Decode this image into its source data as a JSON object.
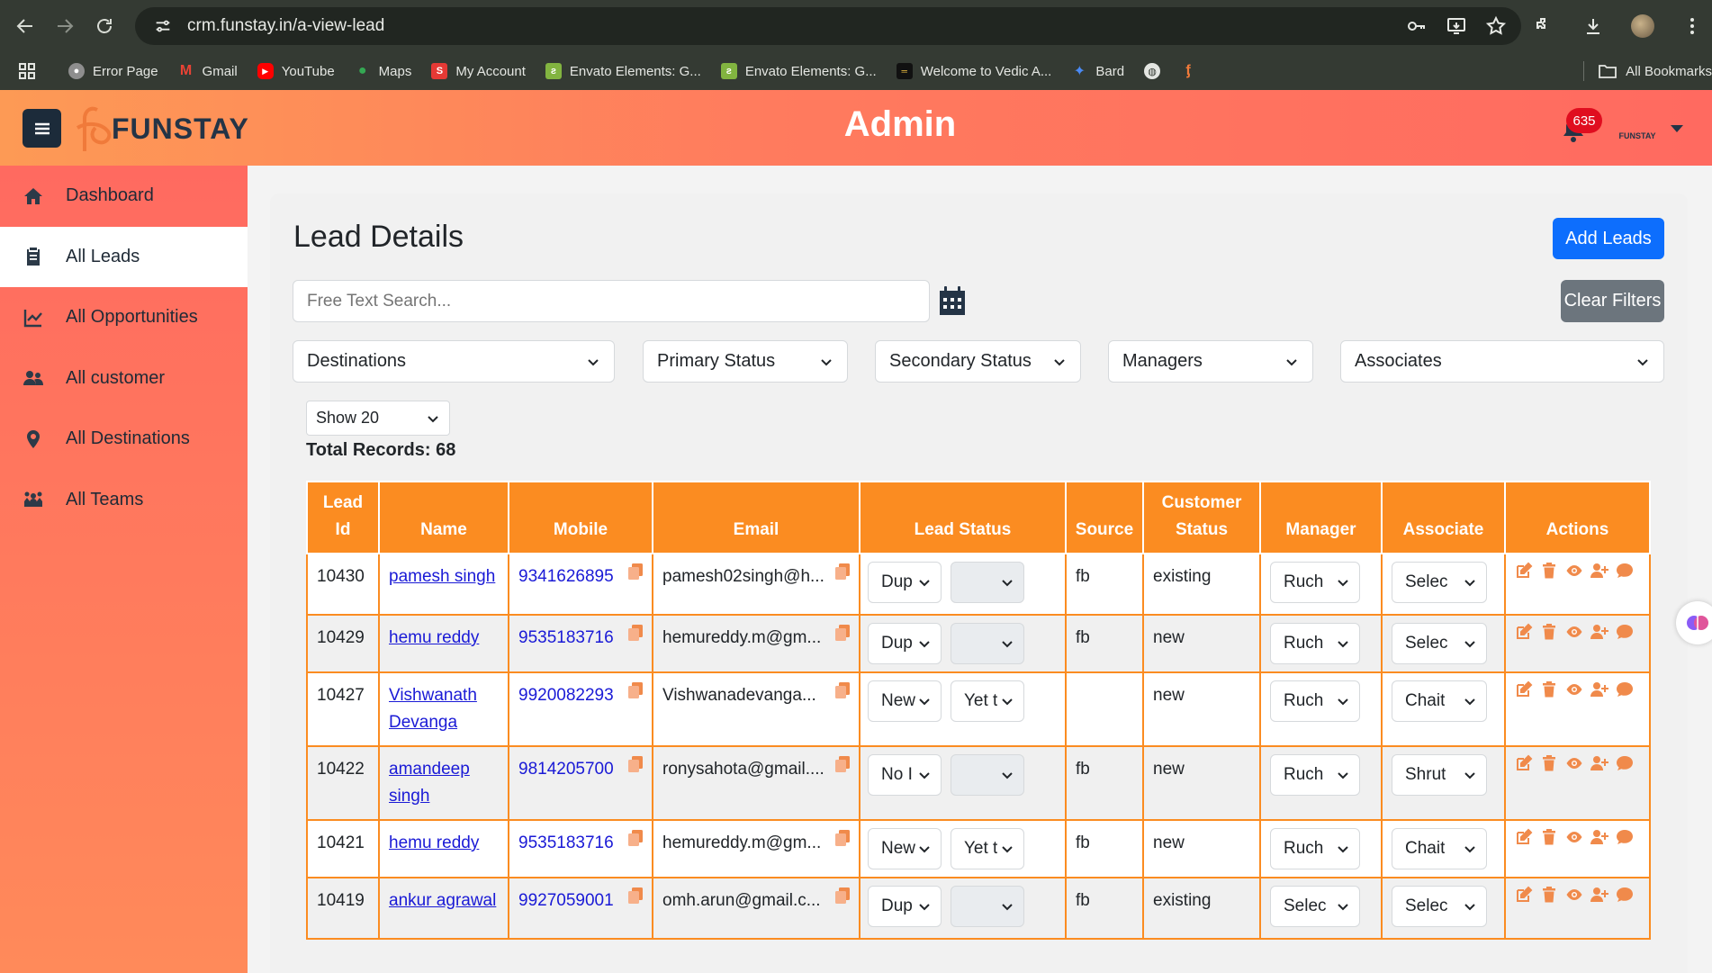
{
  "browser": {
    "url": "crm.funstay.in/a-view-lead",
    "bookmarks": [
      {
        "label": "Error Page",
        "icon": "globe-user-icon",
        "color": "#8e8e8e"
      },
      {
        "label": "Gmail",
        "icon": "gmail-icon",
        "color": "#ea4335"
      },
      {
        "label": "YouTube",
        "icon": "youtube-icon",
        "color": "#ff0000"
      },
      {
        "label": "Maps",
        "icon": "maps-icon",
        "color": "#34a853"
      },
      {
        "label": "My Account",
        "icon": "s-icon",
        "color": "#e53935"
      },
      {
        "label": "Envato Elements: G...",
        "icon": "envato-icon",
        "color": "#82b440"
      },
      {
        "label": "Envato Elements: G...",
        "icon": "envato-icon",
        "color": "#82b440"
      },
      {
        "label": "Welcome to Vedic A...",
        "icon": "vedic-icon",
        "color": "#111111"
      },
      {
        "label": "Bard",
        "icon": "bard-icon",
        "color": "#4a8af4"
      }
    ],
    "all_bookmarks": "All Bookmarks"
  },
  "header": {
    "brand": "FUNSTAY",
    "title": "Admin",
    "notification_count": "635",
    "profile_brand": "FUNSTAY",
    "accent": "#ff7b5e",
    "navy": "#1c2b3a"
  },
  "sidebar": {
    "items": [
      {
        "label": "Dashboard",
        "icon": "home-icon",
        "active": false
      },
      {
        "label": "All Leads",
        "icon": "clipboard-icon",
        "active": true
      },
      {
        "label": "All Opportunities",
        "icon": "chart-line-icon",
        "active": false
      },
      {
        "label": "All customer",
        "icon": "users-icon",
        "active": false
      },
      {
        "label": "All Destinations",
        "icon": "map-pin-icon",
        "active": false
      },
      {
        "label": "All Teams",
        "icon": "team-icon",
        "active": false
      }
    ]
  },
  "main": {
    "title": "Lead Details",
    "add_button": "Add Leads",
    "clear_button": "Clear Filters",
    "search_placeholder": "Free Text Search...",
    "filters": [
      "Destinations",
      "Primary Status",
      "Secondary Status",
      "Managers",
      "Associates"
    ],
    "page_size": "Show 20",
    "total_records": "Total Records: 68"
  },
  "table": {
    "headers": [
      "Lead Id",
      "Name",
      "Mobile",
      "Email",
      "Lead Status",
      "Source",
      "Customer Status",
      "Manager",
      "Associate",
      "Actions"
    ],
    "rows": [
      {
        "id": "10430",
        "name": "pamesh singh",
        "mobile": "9341626895",
        "email": "pamesh02singh@h...",
        "primary": "Dup",
        "secondary": "",
        "source": "fb",
        "customer_status": "existing",
        "manager": "Ruch",
        "associate": "Selec"
      },
      {
        "id": "10429",
        "name": "hemu reddy",
        "mobile": "9535183716",
        "email": "hemureddy.m@gm...",
        "primary": "Dup",
        "secondary": "",
        "source": "fb",
        "customer_status": "new",
        "manager": "Ruch",
        "associate": "Selec"
      },
      {
        "id": "10427",
        "name": "Vishwanath Devanga",
        "mobile": "9920082293",
        "email": "Vishwanadevanga...",
        "primary": "New",
        "secondary": "Yet t",
        "source": "",
        "customer_status": "new",
        "manager": "Ruch",
        "associate": "Chait"
      },
      {
        "id": "10422",
        "name": "amandeep singh",
        "mobile": "9814205700",
        "email": "ronysahota@gmail....",
        "primary": "No I",
        "secondary": "",
        "source": "fb",
        "customer_status": "new",
        "manager": "Ruch",
        "associate": "Shrut"
      },
      {
        "id": "10421",
        "name": "hemu reddy",
        "mobile": "9535183716",
        "email": "hemureddy.m@gm...",
        "primary": "New",
        "secondary": "Yet t",
        "source": "fb",
        "customer_status": "new",
        "manager": "Ruch",
        "associate": "Chait"
      },
      {
        "id": "10419",
        "name": "ankur agrawal",
        "mobile": "9927059001",
        "email": "omh.arun@gmail.c...",
        "primary": "Dup",
        "secondary": "",
        "source": "fb",
        "customer_status": "existing",
        "manager": "Selec",
        "associate": "Selec"
      }
    ],
    "header_color": "#fb8c21",
    "action_icons": [
      "edit-icon",
      "trash-icon",
      "eye-icon",
      "user-plus-icon",
      "comment-icon"
    ]
  }
}
